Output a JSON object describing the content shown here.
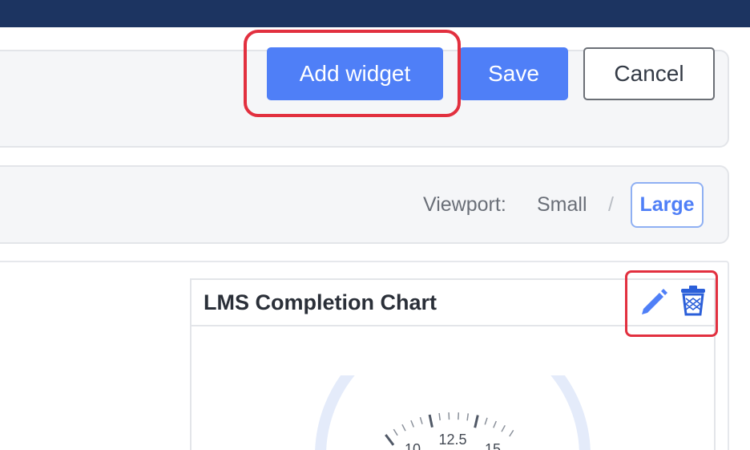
{
  "toolbar": {
    "add_widget_label": "Add widget",
    "save_label": "Save",
    "cancel_label": "Cancel"
  },
  "viewport": {
    "label": "Viewport:",
    "options": [
      "Small",
      "Large"
    ],
    "separator": "/",
    "selected": "Large"
  },
  "widget": {
    "title": "LMS Completion Chart",
    "actions": {
      "edit_icon": "pencil-icon",
      "delete_icon": "trash-icon"
    },
    "gauge_tick_labels": [
      "10",
      "12.5",
      "15"
    ]
  },
  "colors": {
    "topbar": "#1c3461",
    "primary": "#4f7ff7",
    "highlight": "#e2303f",
    "panel": "#f5f6f8",
    "gauge_track": "#e4ebfa"
  }
}
